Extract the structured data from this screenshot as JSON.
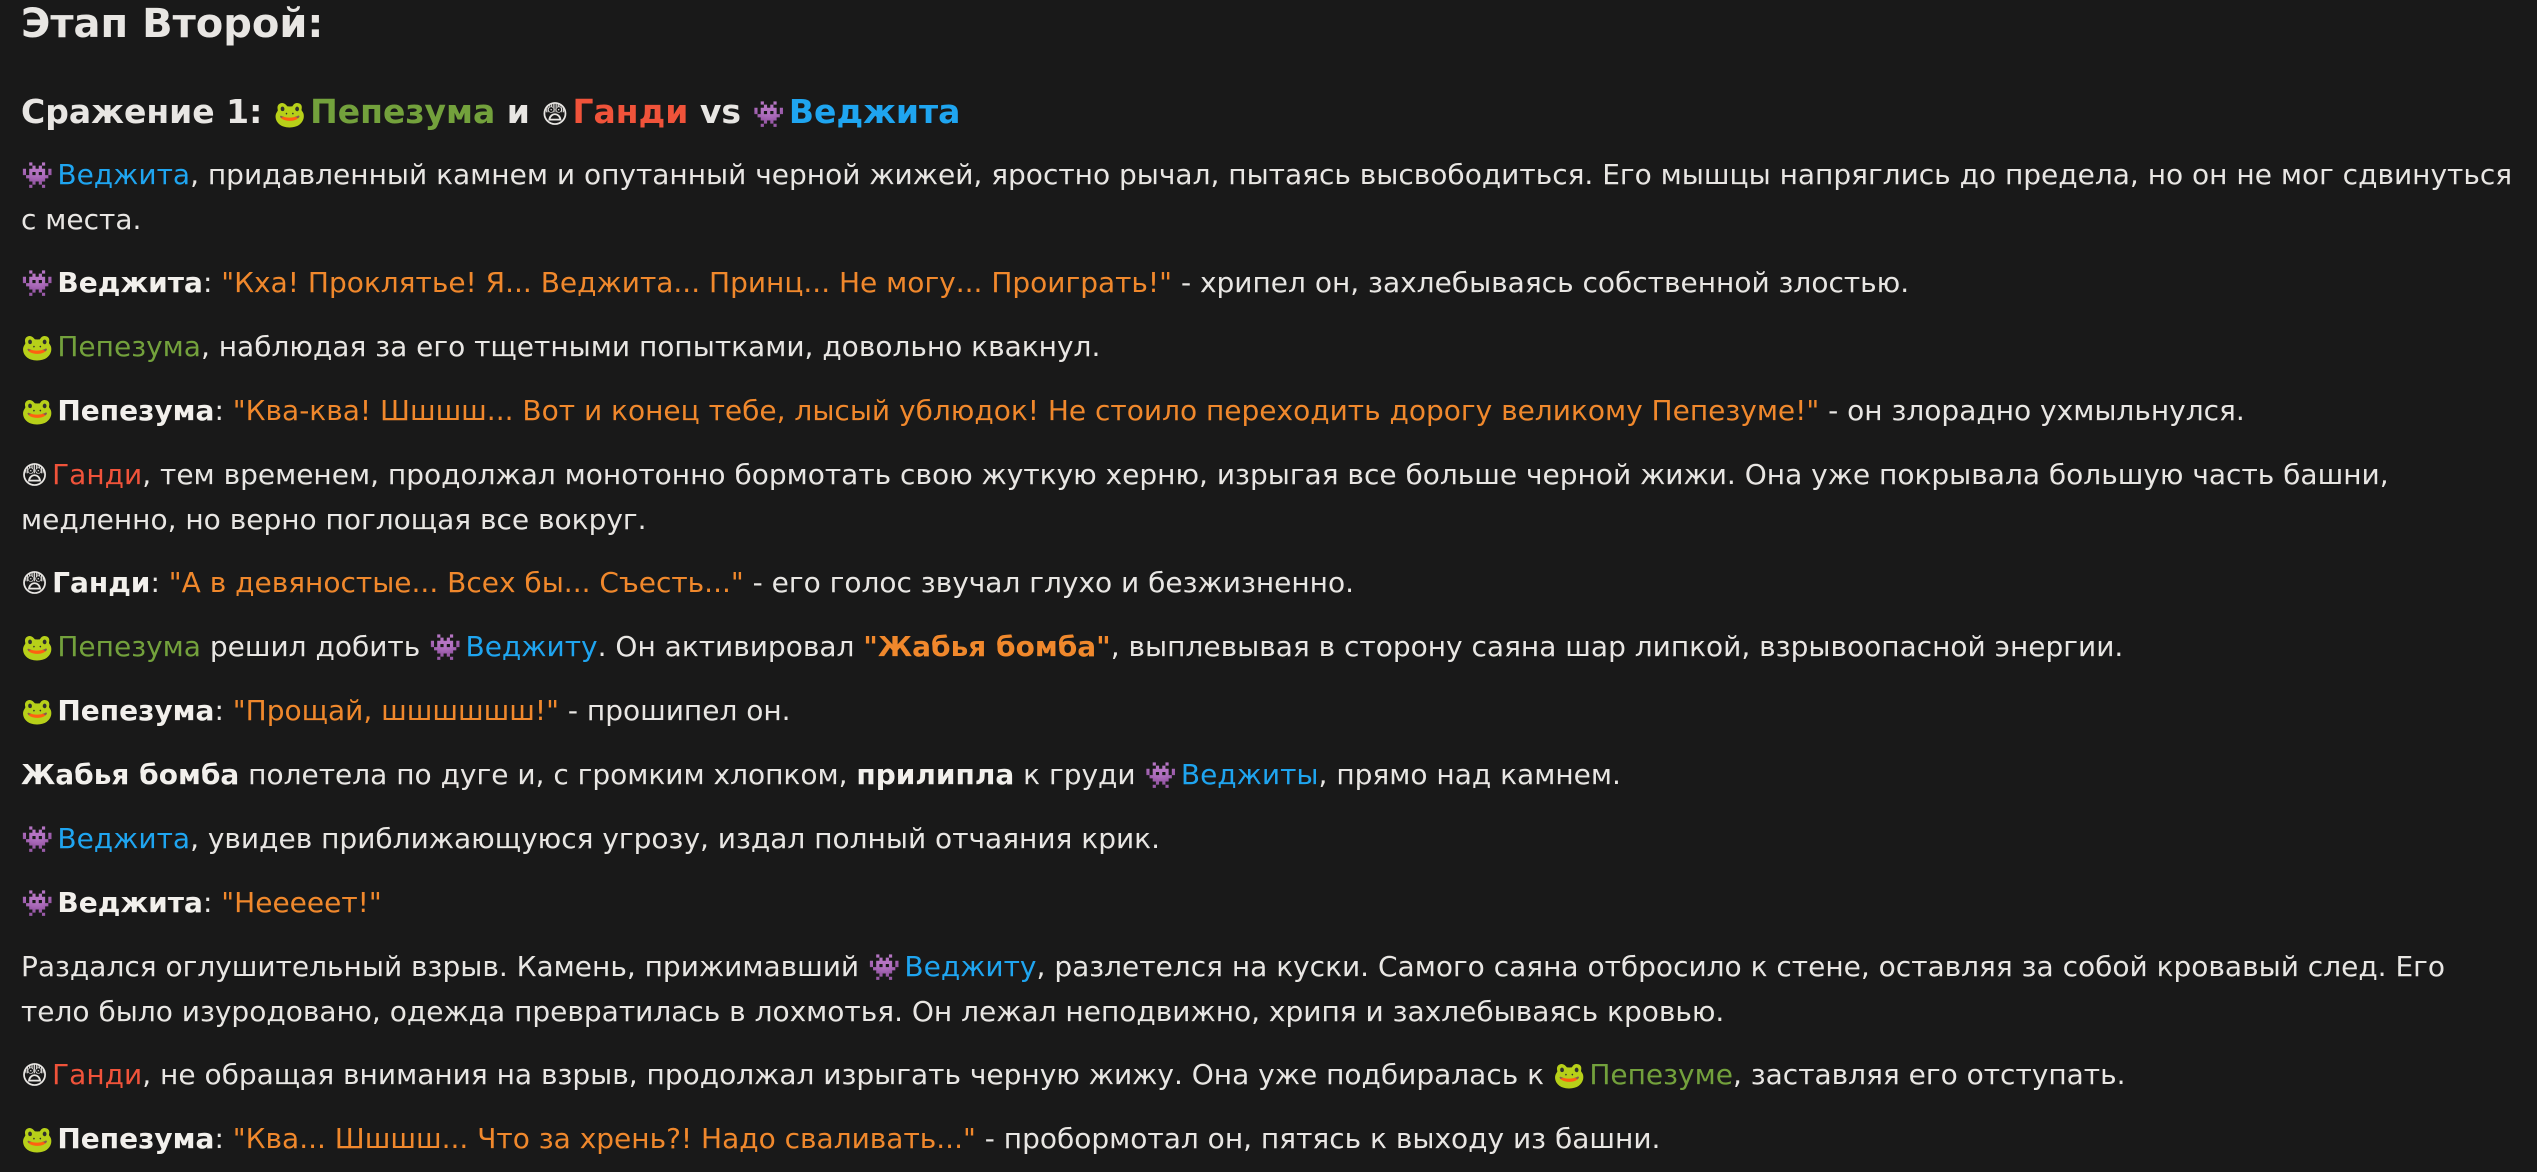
{
  "stage_title": "Этап Второй:",
  "battle": {
    "prefix": "Сражение 1:",
    "emoji_pepe": "🐸",
    "name_pepe": "Пепезума",
    "and": "и",
    "emoji_gandi": "😨",
    "name_gandi": "Ганди",
    "vs": "vs",
    "emoji_veg": "👾",
    "name_veg": "Веджита"
  },
  "emoji": {
    "pepe": "🐸",
    "gandi": "😨",
    "veg": "👾"
  },
  "names": {
    "veg": "Веджита",
    "veg_acc": "Веджиту",
    "veg_gen": "Веджиты",
    "pepe": "Пепезума",
    "pepe_dat": "Пепезуме",
    "gandi": "Ганди"
  },
  "paragraphs": {
    "p1_rest": ", придавленный камнем и опутанный черной жижей, яростно рычал, пытаясь высвободиться. Его мышцы напряглись до предела, но он не мог сдвинуться с места.",
    "p2_quote": "\"Кха! Проклятье! Я... Веджита... Принц... Не могу... Проиграть!\"",
    "p2_rest": " - хрипел он, захлебываясь собственной злостью.",
    "p3_rest": ", наблюдая за его тщетными попытками, довольно квакнул.",
    "p4_quote": "\"Ква-ква! Шшшш... Вот и конец тебе, лысый ублюдок! Не стоило переходить дорогу великому Пепезуме!\"",
    "p4_rest": " - он злорадно ухмыльнулся.",
    "p5_rest": ", тем временем, продолжал монотонно бормотать свою жуткую херню, изрыгая все больше черной жижи. Она уже покрывала большую часть башни, медленно, но верно поглощая все вокруг.",
    "p6_quote": "\"А в девяностые... Всех бы... Съесть...\"",
    "p6_rest": " - его голос звучал глухо и безжизненно.",
    "p7_mid": " решил добить ",
    "p7_mid2": ". Он активировал ",
    "p7_bomb": "\"Жабья бомба\"",
    "p7_rest": ", выплевывая в сторону саяна шар липкой, взрывоопасной энергии.",
    "p8_quote": "\"Прощай, шшшшшш!\"",
    "p8_rest": " - прошипел он.",
    "p9_bomb": "Жабья бомба",
    "p9_mid": " полетела по дуге и, с громким хлопком, ",
    "p9_stick": "прилипла",
    "p9_mid2": " к груди ",
    "p9_rest": ", прямо над камнем.",
    "p10_rest": ", увидев приближающуюся угрозу, издал полный отчаяния крик.",
    "p11_quote": "\"Нееееет!\"",
    "p12_start": "Раздался оглушительный взрыв. Камень, прижимавший ",
    "p12_rest": ", разлетелся на куски. Самого саяна отбросило к стене, оставляя за собой кровавый след. Его тело было изуродовано, одежда превратилась в лохмотья. Он лежал неподвижно, хрипя и захлебываясь кровью.",
    "p13_mid": ", не обращая внимания на взрыв, продолжал изрыгать черную жижу. Она уже подбиралась к ",
    "p13_rest": ", заставляя его отступать.",
    "p14_quote": "\"Ква... Шшшш... Что за хрень?! Надо сваливать...\"",
    "p14_rest": " - пробормотал он, пятясь к выходу из башни."
  },
  "colon": ": ",
  "colors": {
    "background": "#191919",
    "text": "#e8e6e3",
    "pepe": "#73a13c",
    "gandi": "#f0533a",
    "veg": "#1fa5f0",
    "quote": "#f0882c"
  }
}
